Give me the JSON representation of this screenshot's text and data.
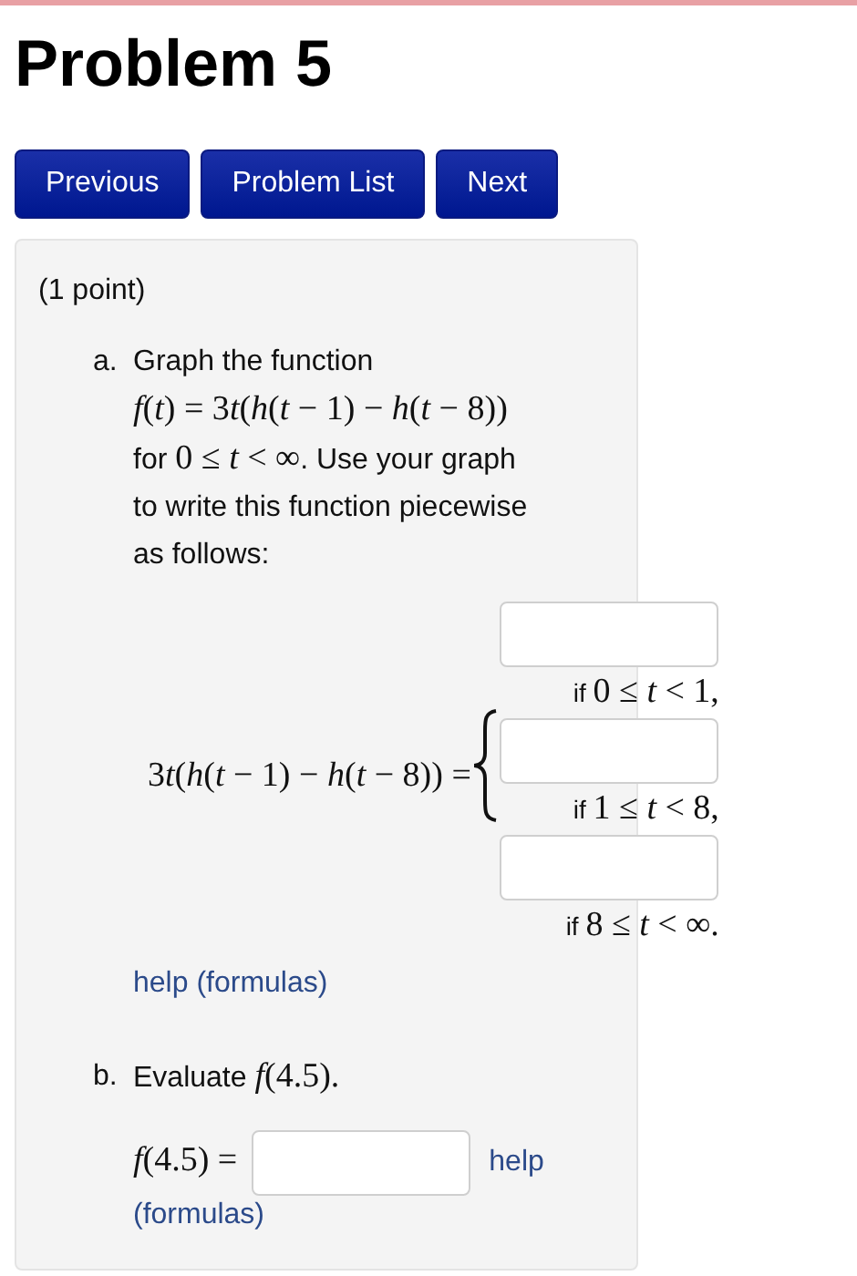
{
  "title": "Problem 5",
  "nav_buttons": [
    {
      "label": "Previous"
    },
    {
      "label": "Problem List"
    },
    {
      "label": "Next"
    }
  ],
  "points": "(1 point)",
  "part_a": {
    "marker": "a.",
    "prompt_lines": [
      [
        {
          "kind": "text",
          "s": "Graph the function"
        }
      ],
      [
        {
          "kind": "math",
          "s": "f(t) = 3t(h(t − 1) − h(t − 8))"
        }
      ],
      [
        {
          "kind": "text",
          "s": "for "
        },
        {
          "kind": "math",
          "s": "0 ≤ t < ∞"
        },
        {
          "kind": "text",
          "s": ". Use your graph"
        }
      ],
      [
        {
          "kind": "text",
          "s": "to write this function piecewise"
        }
      ],
      [
        {
          "kind": "text",
          "s": "as follows:"
        }
      ]
    ],
    "lhs": "3t(h(t − 1) − h(t − 8)) =",
    "cases": [
      {
        "condition": [
          {
            "kind": "text",
            "s": "if "
          },
          {
            "kind": "math",
            "s": "0 ≤ t < 1,"
          }
        ]
      },
      {
        "condition": [
          {
            "kind": "text",
            "s": "if "
          },
          {
            "kind": "math",
            "s": "1 ≤ t < 8,"
          }
        ]
      },
      {
        "condition": [
          {
            "kind": "text",
            "s": "if "
          },
          {
            "kind": "math",
            "s": "8 ≤ t < ∞."
          }
        ]
      }
    ],
    "help_link": "help (formulas)"
  },
  "part_b": {
    "marker": "b.",
    "prompt": [
      {
        "kind": "text",
        "s": "Evaluate "
      },
      {
        "kind": "math",
        "s": "f(4.5)."
      }
    ],
    "answer_label": "f(4.5) =",
    "help_link_parts": [
      "help",
      "(formulas)"
    ]
  }
}
